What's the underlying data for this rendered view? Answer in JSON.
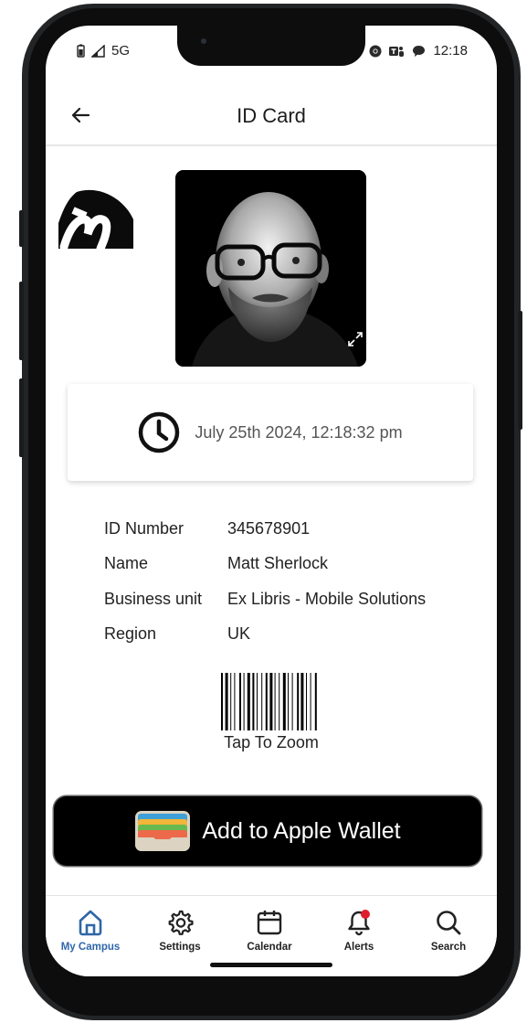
{
  "status_bar": {
    "network": "5G",
    "time": "12:18"
  },
  "header": {
    "title": "ID Card"
  },
  "timestamp": "July 25th 2024, 12:18:32 pm",
  "details": [
    {
      "label": "ID Number",
      "value": "345678901"
    },
    {
      "label": "Name",
      "value": "Matt Sherlock"
    },
    {
      "label": "Business unit",
      "value": "Ex Libris - Mobile Solutions"
    },
    {
      "label": "Region",
      "value": "UK"
    }
  ],
  "barcode": {
    "caption": "Tap To Zoom"
  },
  "wallet_button": {
    "label": "Add to Apple Wallet"
  },
  "tabs": [
    {
      "label": "My Campus",
      "icon": "home-icon",
      "active": true
    },
    {
      "label": "Settings",
      "icon": "gear-icon"
    },
    {
      "label": "Calendar",
      "icon": "calendar-icon"
    },
    {
      "label": "Alerts",
      "icon": "bell-icon",
      "badge": true
    },
    {
      "label": "Search",
      "icon": "search-icon"
    }
  ],
  "colors": {
    "accent": "#2f66a8",
    "alert_badge": "#e01e2b",
    "wallet_bg": "#000000"
  }
}
